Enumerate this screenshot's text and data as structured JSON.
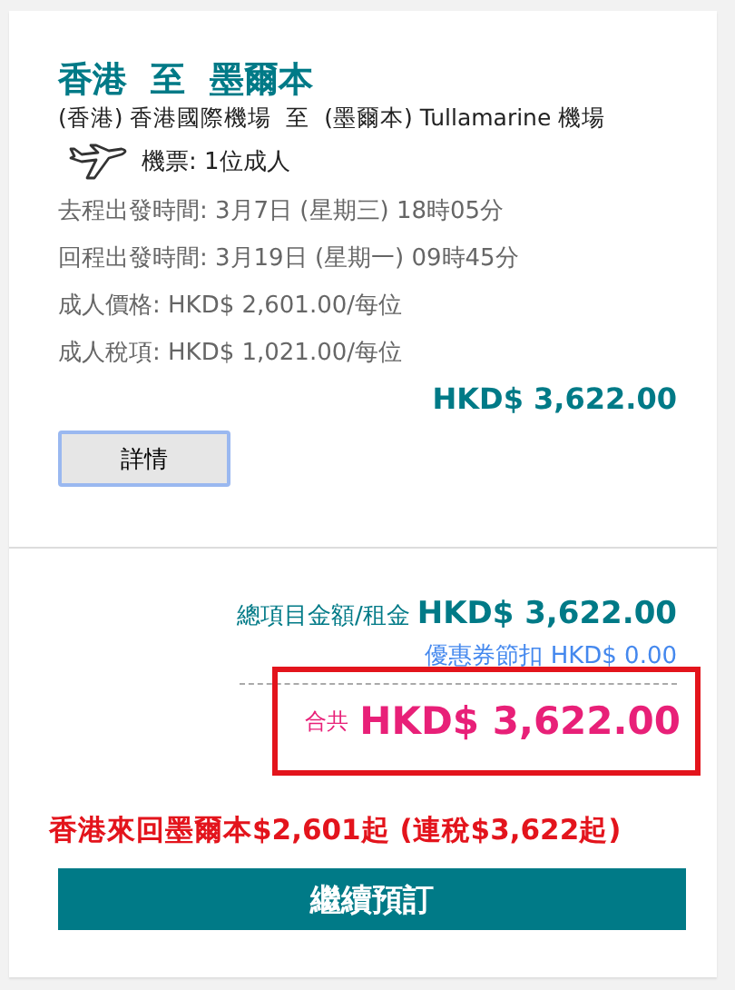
{
  "route": {
    "title": "香港  至  墨爾本",
    "airports": "(香港) 香港國際機場  至  (墨爾本) Tullamarine 機場",
    "tickets": "機票: 1位成人"
  },
  "details": [
    {
      "label": "去程出發時間:",
      "value": "3月7日 (星期三) 18時05分"
    },
    {
      "label": "回程出發時間:",
      "value": "3月19日 (星期一) 09時45分"
    },
    {
      "label": "成人價格:",
      "value": "HKD$ 2,601.00/每位"
    },
    {
      "label": "成人稅項:",
      "value": "HKD$ 1,021.00/每位"
    }
  ],
  "subtotal": "HKD$ 3,622.00",
  "details_button": "詳情",
  "summary": {
    "fare_label": "總項目金額/租金",
    "fare_amount": "HKD$ 3,622.00",
    "coupon": "優惠券節扣 HKD$ 0.00",
    "total_label": "合共",
    "total_amount": "HKD$ 3,622.00"
  },
  "promo": "香港來回墨爾本$2,601起 (連稅$3,622起)",
  "continue_button": "繼續預訂"
}
